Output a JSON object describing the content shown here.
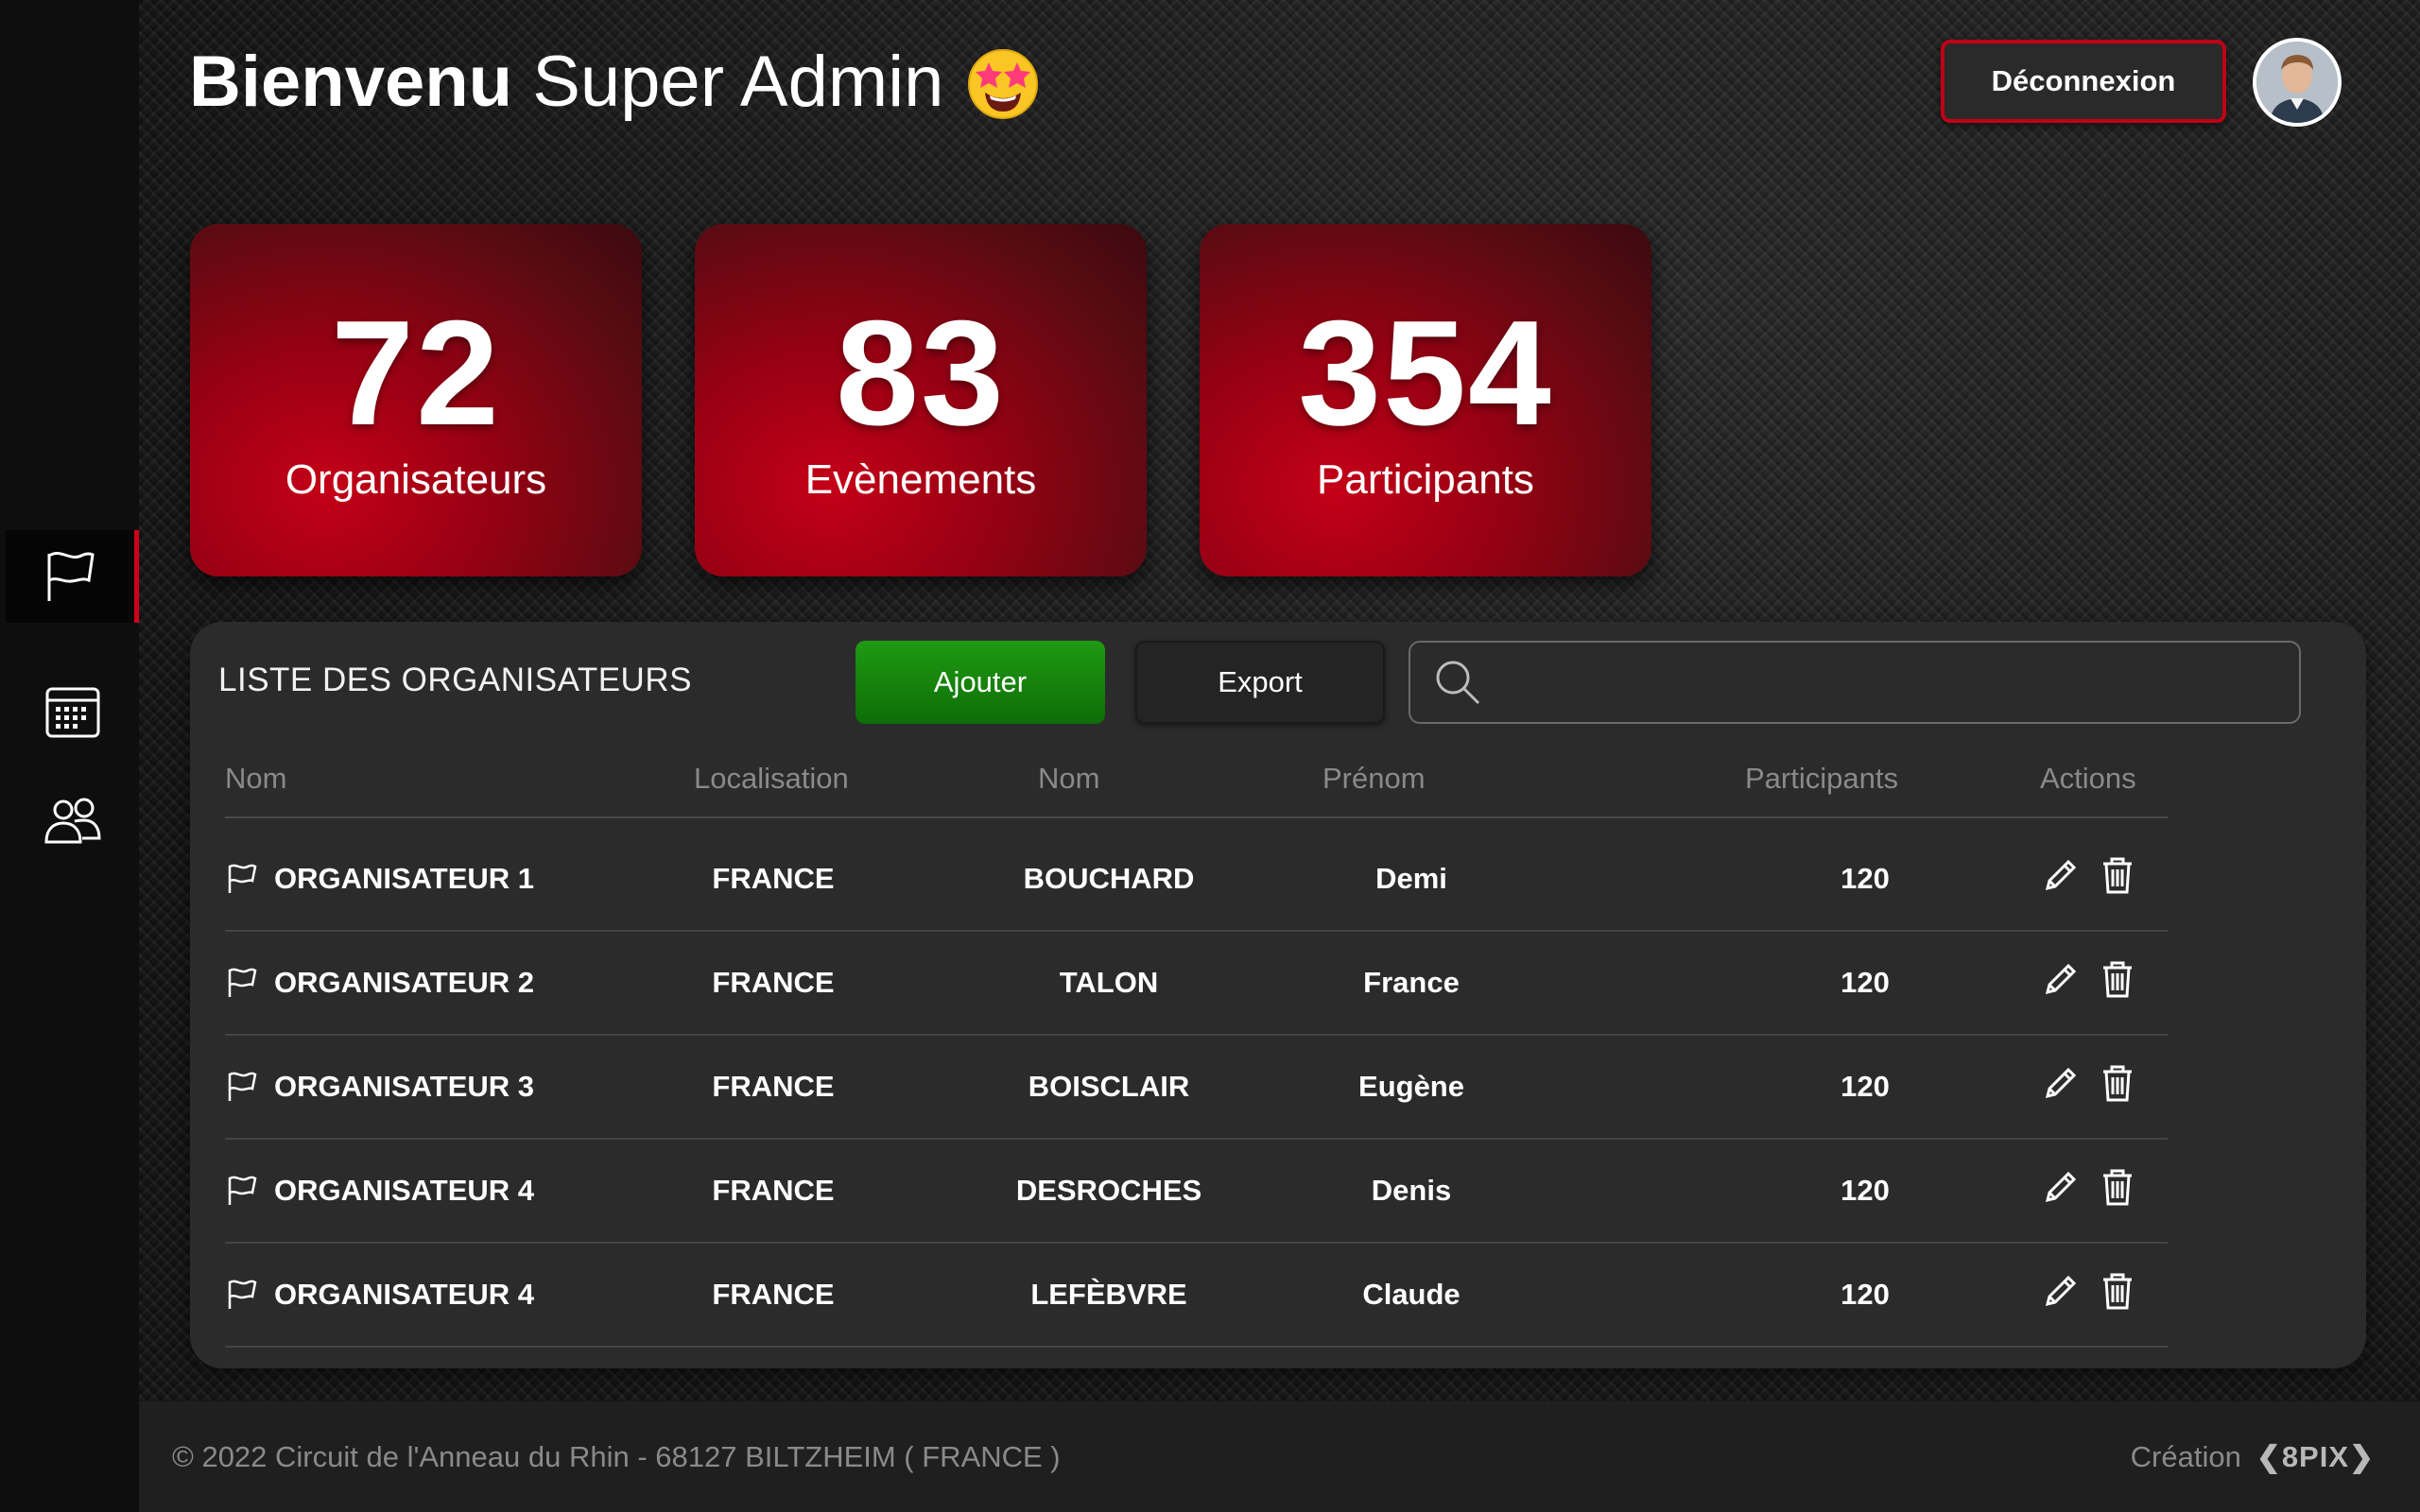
{
  "header": {
    "welcome_bold": "Bienvenu",
    "welcome_rest": "Super Admin",
    "emoji": "star-struck-emoji",
    "logout_label": "Déconnexion",
    "avatar": "user-avatar"
  },
  "sidebar": {
    "items": [
      {
        "icon": "flag-icon",
        "active": true
      },
      {
        "icon": "calendar-icon",
        "active": false
      },
      {
        "icon": "users-icon",
        "active": false
      }
    ]
  },
  "stats": [
    {
      "value": "72",
      "label": "Organisateurs"
    },
    {
      "value": "83",
      "label": "Evènements"
    },
    {
      "value": "354",
      "label": "Participants"
    }
  ],
  "panel": {
    "title": "LISTE DES ORGANISATEURS",
    "add_label": "Ajouter",
    "export_label": "Export",
    "search_placeholder": ""
  },
  "table": {
    "columns": [
      "Nom",
      "Localisation",
      "Nom",
      "Prénom",
      "Participants",
      "Actions"
    ],
    "rows": [
      {
        "organizer": "ORGANISATEUR 1",
        "location": "FRANCE",
        "last_name": "BOUCHARD",
        "first_name": "Demi",
        "participants": "120"
      },
      {
        "organizer": "ORGANISATEUR 2",
        "location": "FRANCE",
        "last_name": "TALON",
        "first_name": "France",
        "participants": "120"
      },
      {
        "organizer": "ORGANISATEUR 3",
        "location": "FRANCE",
        "last_name": "BOISCLAIR",
        "first_name": "Eugène",
        "participants": "120"
      },
      {
        "organizer": "ORGANISATEUR 4",
        "location": "FRANCE",
        "last_name": "DESROCHES",
        "first_name": "Denis",
        "participants": "120"
      },
      {
        "organizer": "ORGANISATEUR 4",
        "location": "FRANCE",
        "last_name": "LEFÈBVRE",
        "first_name": "Claude",
        "participants": "120"
      }
    ]
  },
  "footer": {
    "copyright": "© 2022 Circuit de l'Anneau du Rhin - 68127 BILTZHEIM ( FRANCE )",
    "credit_label": "Création",
    "credit_brand": "❮8PIX❯"
  },
  "colors": {
    "accent_red": "#c00016",
    "add_green": "#1f9a12"
  }
}
